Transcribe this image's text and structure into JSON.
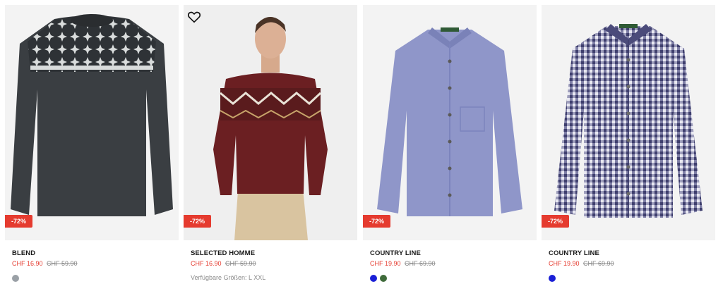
{
  "products": [
    {
      "brand": "BLEND",
      "price_now": "CHF 16.90",
      "price_was": "CHF 59.90",
      "discount": "-72%",
      "image": "charcoal-knit-sweater-snowflake-pattern",
      "swatches": [
        "#9aa0a6"
      ]
    },
    {
      "brand": "SELECTED HOMME",
      "price_now": "CHF 16.90",
      "price_was": "CHF 59.90",
      "discount": "-72%",
      "image": "man-wearing-burgundy-patterned-sweater",
      "sizes": "Verfügbare Größen: L XXL",
      "wishlist_icon": "heart-outline-icon"
    },
    {
      "brand": "COUNTRY LINE",
      "price_now": "CHF 19.90",
      "price_was": "CHF 69.90",
      "discount": "-72%",
      "image": "light-blue-button-shirt",
      "swatches": [
        "#1a1fd6",
        "#3f6b3a"
      ]
    },
    {
      "brand": "COUNTRY LINE",
      "price_now": "CHF 19.90",
      "price_was": "CHF 69.90",
      "discount": "-72%",
      "image": "navy-gingham-check-shirt",
      "swatches": [
        "#1a1fd6"
      ]
    }
  ],
  "colors": {
    "sale": "#e53b2f",
    "card_bg": "#f3f3f3"
  }
}
